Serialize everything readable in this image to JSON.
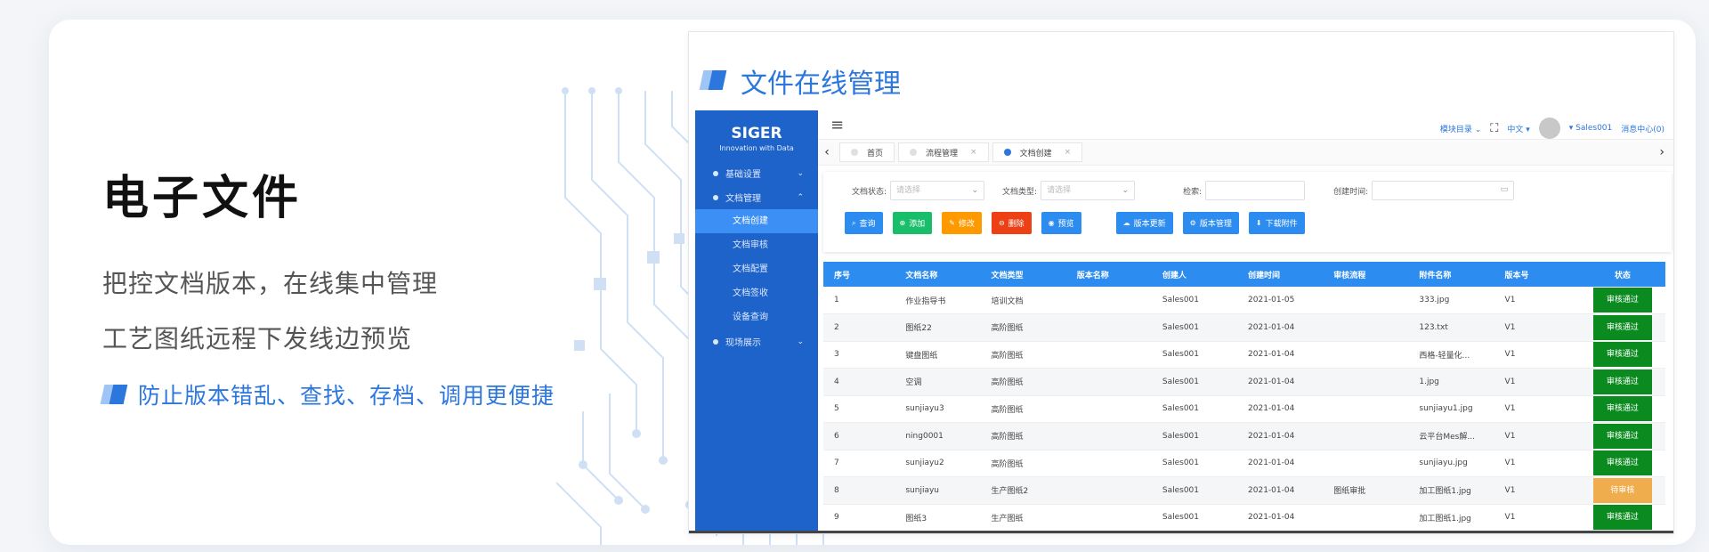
{
  "hero": {
    "title": "电子文件",
    "line1": "把控文档版本，在线集中管理",
    "line2": "工艺图纸远程下发线边预览",
    "hint": "防止版本错乱、查找、存档、调用更便捷"
  },
  "window": {
    "title": "文件在线管理"
  },
  "sidebar": {
    "brand": "SIGER",
    "brand_sub": "Innovation with Data",
    "groups": [
      {
        "label": "基础设置",
        "chevron": "⌄"
      },
      {
        "label": "文档管理",
        "chevron": "⌃"
      },
      {
        "label": "现场展示",
        "chevron": "⌄"
      }
    ],
    "sub_items": [
      "文档创建",
      "文档审核",
      "文档配置",
      "文档签收",
      "设备查询"
    ]
  },
  "topbar": {
    "module": "模块目录 ⌄",
    "lang": "中文 ▾",
    "user": "▾ Sales001",
    "messages": "消息中心(0)"
  },
  "tabs": [
    {
      "label": "首页"
    },
    {
      "label": "流程管理"
    },
    {
      "label": "文档创建"
    }
  ],
  "filters": {
    "status_label": "文档状态:",
    "type_label": "文档类型:",
    "search_label": "检索:",
    "time_label": "创建时间:",
    "placeholder": "请选择"
  },
  "buttons": [
    "查询",
    "添加",
    "修改",
    "删除",
    "预览",
    "版本更新",
    "版本管理",
    "下载附件"
  ],
  "table": {
    "columns": [
      "序号",
      "文档名称",
      "文档类型",
      "版本名称",
      "创建人",
      "创建时间",
      "审核流程",
      "附件名称",
      "版本号",
      "状态"
    ],
    "rows": [
      [
        "1",
        "作业指导书",
        "培训文档",
        "",
        "Sales001",
        "2021-01-05",
        "",
        "333.jpg",
        "V1",
        "审核通过"
      ],
      [
        "2",
        "图纸22",
        "高阶图纸",
        "",
        "Sales001",
        "2021-01-04",
        "",
        "123.txt",
        "V1",
        "审核通过"
      ],
      [
        "3",
        "键盘图纸",
        "高阶图纸",
        "",
        "Sales001",
        "2021-01-04",
        "",
        "西格-轻量化...",
        "V1",
        "审核通过"
      ],
      [
        "4",
        "空调",
        "高阶图纸",
        "",
        "Sales001",
        "2021-01-04",
        "",
        "1.jpg",
        "V1",
        "审核通过"
      ],
      [
        "5",
        "sunjiayu3",
        "高阶图纸",
        "",
        "Sales001",
        "2021-01-04",
        "",
        "sunjiayu1.jpg",
        "V1",
        "审核通过"
      ],
      [
        "6",
        "ning0001",
        "高阶图纸",
        "",
        "Sales001",
        "2021-01-04",
        "",
        "云平台Mes解...",
        "V1",
        "审核通过"
      ],
      [
        "7",
        "sunjiayu2",
        "高阶图纸",
        "",
        "Sales001",
        "2021-01-04",
        "",
        "sunjiayu.jpg",
        "V1",
        "审核通过"
      ],
      [
        "8",
        "sunjiayu",
        "生产图纸2",
        "",
        "Sales001",
        "2021-01-04",
        "图纸审批",
        "加工图纸1.jpg",
        "V1",
        "待审核"
      ],
      [
        "9",
        "图纸3",
        "生产图纸",
        "",
        "Sales001",
        "2021-01-04",
        "",
        "加工图纸1.jpg",
        "V1",
        "审核通过"
      ]
    ],
    "status_colors": {
      "审核通过": "#0a8a1f",
      "待审核": "#f0ad4e"
    }
  },
  "colors": {
    "accent": "#2b77de",
    "sidebar": "#1e63c9",
    "table_header": "#2d8cf0"
  }
}
